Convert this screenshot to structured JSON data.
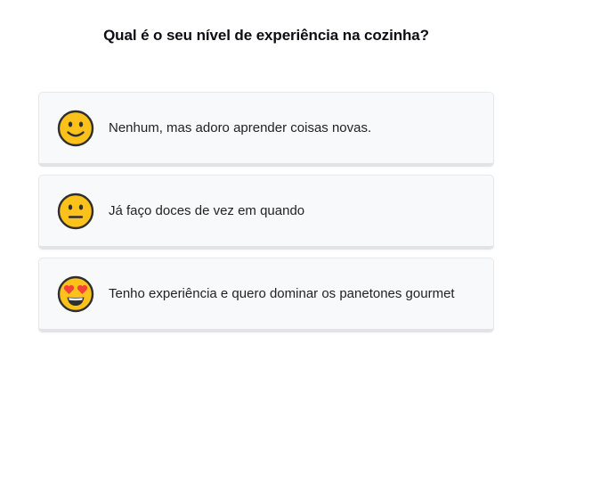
{
  "question": {
    "title": "Qual é o seu nível de experiência na cozinha?"
  },
  "options": [
    {
      "icon": "slightly-smiling-face-icon",
      "label": "Nenhum, mas adoro aprender coisas novas."
    },
    {
      "icon": "neutral-face-icon",
      "label": "Já faço doces de vez em quando"
    },
    {
      "icon": "heart-eyes-face-icon",
      "label": "Tenho experiência e quero dominar os panetones gourmet"
    }
  ],
  "colors": {
    "emoji_yellow": "#fcc21b",
    "emoji_outline": "#2f2f2f",
    "heart_red": "#f44336",
    "card_background": "#f8f9fa",
    "card_border": "#e2e3e7"
  }
}
